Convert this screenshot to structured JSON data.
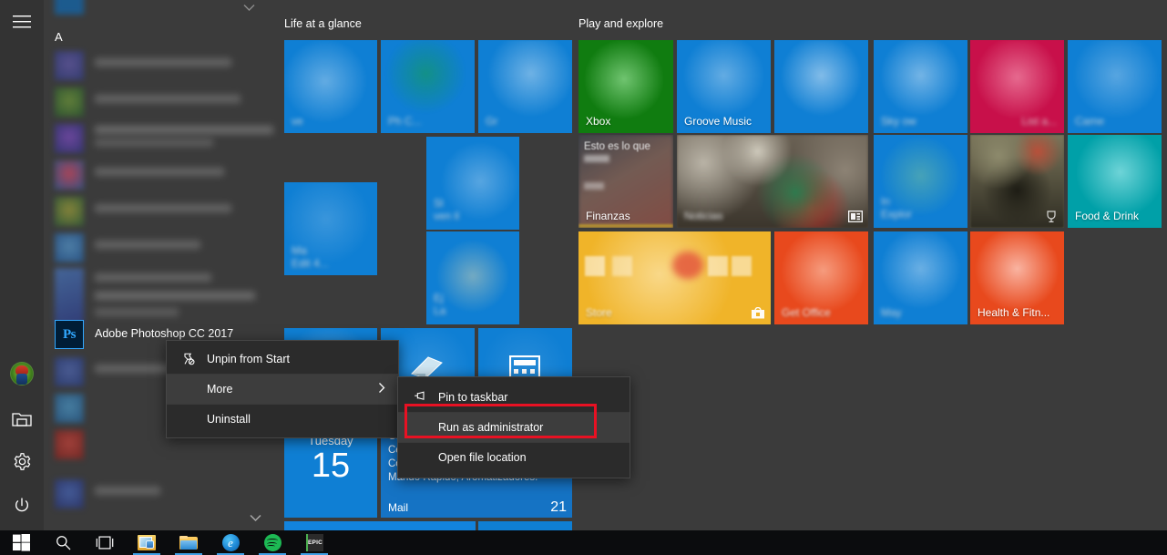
{
  "window": {
    "title": "Windows 10 Start Menu"
  },
  "rail": {
    "items": [
      {
        "name": "hamburger",
        "label": "Menu"
      },
      {
        "name": "avatar",
        "label": "User account"
      },
      {
        "name": "explorer",
        "label": "File Explorer"
      },
      {
        "name": "settings",
        "label": "Settings"
      },
      {
        "name": "power",
        "label": "Power"
      }
    ]
  },
  "app_list": {
    "section_letter": "A",
    "apps": [
      {
        "label": "",
        "blurred": true,
        "icon_color": "#3c4a8f"
      },
      {
        "label": "",
        "blurred": true,
        "icon_color": "#4d7a2e"
      },
      {
        "label": "",
        "blurred": true,
        "icon_color": "#5b2fa8"
      },
      {
        "label": "",
        "blurred": true,
        "icon_color": "#d0344f"
      },
      {
        "label": "",
        "blurred": true,
        "icon_color": "#6a7a24"
      },
      {
        "label": "",
        "blurred": true,
        "icon_color": "#2f6fb5"
      },
      {
        "label": "",
        "blurred": true,
        "icon_color": "#2a5ea8"
      },
      {
        "label": "Adobe Photoshop CC 2017",
        "blurred": false,
        "icon_color": "#001d36",
        "icon_glyph": "Ps"
      },
      {
        "label": "",
        "blurred": true,
        "icon_color": "#34559c"
      }
    ],
    "scroll_down_icon": "chevron-down-icon",
    "scroll_up_icon": "chevron-down-icon"
  },
  "tile_groups": [
    {
      "title": "Life at a glance"
    },
    {
      "title": "Play and explore"
    }
  ],
  "tiles": [
    {
      "name": "tile-unknown-1",
      "label": "ve",
      "color": "#0f7fd4",
      "blurred": true
    },
    {
      "name": "tile-photos",
      "label": "Ph       C...",
      "color": "#0f7fd4",
      "blurred": true
    },
    {
      "name": "tile-groove",
      "label": "Gr",
      "color": "#0f7fd4",
      "blurred": true
    },
    {
      "name": "tile-maps-edit",
      "label": "Ma\nEdit        4...",
      "color": "#0f7fd4",
      "blurred": true
    },
    {
      "name": "tile-sl-ven",
      "label": "Sl\nven  ll",
      "color": "#0f7fd4",
      "blurred": true
    },
    {
      "name": "tile-ej-la",
      "label": "Ej\nLa",
      "color": "#0f7fd4",
      "blurred": true
    },
    {
      "name": "tile-calendar",
      "label": "",
      "color": "#0f7fd4",
      "blurred": false,
      "day": "Tuesday",
      "date": "15"
    },
    {
      "name": "tile-mail",
      "label": "Mail",
      "color": "#1573c4",
      "blurred": false,
      "mail_lines": [
        "Gr",
        "Ce",
        "Cortinas Black Out, Toallas de",
        "Mando Rápido, Aromatizadores."
      ],
      "mail_count": "21"
    },
    {
      "name": "tile-xbox",
      "label": "Xbox",
      "color": "#107c10",
      "blurred": false
    },
    {
      "name": "tile-groove-music",
      "label": "Groove Music",
      "color": "#0f7fd4",
      "blurred": false
    },
    {
      "name": "tile-movies",
      "label": "",
      "color": "#0f7fd4",
      "blurred": true
    },
    {
      "name": "tile-finanzas",
      "label": "Finanzas",
      "color": "#2f3238",
      "blurred": false,
      "headline": "Esto es lo que"
    },
    {
      "name": "tile-noticias",
      "label": "Noticias",
      "color": "#4a4238",
      "blurred": false
    },
    {
      "name": "tile-store",
      "label": "Store",
      "color": "#f0b429",
      "blurred": false
    },
    {
      "name": "tile-get-office",
      "label": "Get Office",
      "color": "#e8491d",
      "blurred": false
    },
    {
      "name": "tile-skype",
      "label": "Sky        ow",
      "color": "#0f7fd4",
      "blurred": true
    },
    {
      "name": "tile-list-a",
      "label": "List a...",
      "color": "#c8104a",
      "blurred": true
    },
    {
      "name": "tile-camera",
      "label": "Came",
      "color": "#0f7fd4",
      "blurred": true
    },
    {
      "name": "tile-explore",
      "label": "In\nExplor",
      "color": "#0f7fd4",
      "blurred": true
    },
    {
      "name": "tile-photo-live",
      "label": "",
      "color": "#5a5641",
      "blurred": true
    },
    {
      "name": "tile-food-drink",
      "label": "Food & Drink",
      "color": "#00a0a8",
      "blurred": false
    },
    {
      "name": "tile-maps",
      "label": "May",
      "color": "#0f7fd4",
      "blurred": true
    },
    {
      "name": "tile-health",
      "label": "Health & Fitn...",
      "color": "#e8491d",
      "blurred": false
    }
  ],
  "context_menu_primary": {
    "items": [
      {
        "label": "Unpin from Start",
        "icon": "unpin-icon",
        "selected": false,
        "submenu": false
      },
      {
        "label": "More",
        "icon": "",
        "selected": true,
        "submenu": true
      },
      {
        "label": "Uninstall",
        "icon": "",
        "selected": false,
        "submenu": false
      }
    ]
  },
  "context_menu_submenu": {
    "items": [
      {
        "label": "Pin to taskbar",
        "icon": "pin-icon",
        "highlighted": false
      },
      {
        "label": "Run as administrator",
        "icon": "",
        "highlighted": true
      },
      {
        "label": "Open file location",
        "icon": "",
        "highlighted": false
      }
    ],
    "highlight_color": "#e81123"
  },
  "taskbar": {
    "items": [
      {
        "name": "start-button",
        "icon": "windows-logo-icon",
        "open": false
      },
      {
        "name": "search-button",
        "icon": "search-icon",
        "open": false
      },
      {
        "name": "task-view-button",
        "icon": "task-view-icon",
        "open": false
      },
      {
        "name": "photos-app",
        "icon": "photo-app-icon",
        "open": true
      },
      {
        "name": "file-explorer",
        "icon": "folder-icon",
        "open": true
      },
      {
        "name": "edge-browser",
        "icon": "edge-icon",
        "open": true
      },
      {
        "name": "spotify",
        "icon": "spotify-icon",
        "open": true
      },
      {
        "name": "epic-games",
        "icon": "epic-icon",
        "open": true
      }
    ],
    "edge_glyph": "e",
    "epic_glyph": "EPIC"
  }
}
